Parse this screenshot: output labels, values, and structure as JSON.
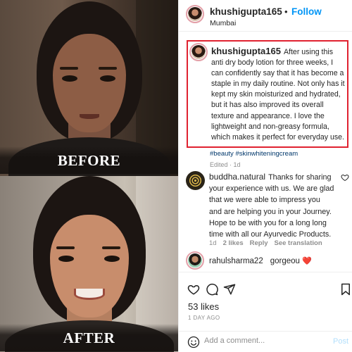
{
  "photos": {
    "before_label": "BEFORE",
    "after_label": "AFTER"
  },
  "header": {
    "username": "khushigupta165",
    "separator": "•",
    "follow_label": "Follow",
    "location": "Mumbai"
  },
  "caption": {
    "username": "khushigupta165",
    "text": "After using this anti dry body lotion for three weeks, I can confidently say that it has become a staple in my daily routine. Not only has it kept my skin moisturized and hydrated, but it has also improved its overall texture and appearance. I love the lightweight and non-greasy formula, which makes it perfect for everyday use.",
    "hashtags": "#beauty #skinwhiteningcream",
    "edited": "Edited · 1d"
  },
  "comments": [
    {
      "username": "buddha.natural",
      "text": "Thanks for sharing your experience with us. We are glad that we were able to impress you and are helping you in your Journey. Hope to be with you for a long long time with all our Ayurvedic Products.",
      "time": "1d",
      "likes": "2 likes",
      "reply": "Reply",
      "translation": "See translation"
    },
    {
      "username": "rahulsharma22",
      "text": "gorgeou",
      "emoji": "❤️"
    }
  ],
  "actions": {
    "likes": "53 likes",
    "date": "1 DAY AGO",
    "icons": [
      "heart-icon",
      "comment-icon",
      "share-icon",
      "bookmark-icon"
    ]
  },
  "add_comment": {
    "placeholder": "Add a comment...",
    "post_label": "Post"
  },
  "colors": {
    "accent": "#0095f6",
    "caption_outline": "#e02230",
    "heart": "#ed4956"
  }
}
